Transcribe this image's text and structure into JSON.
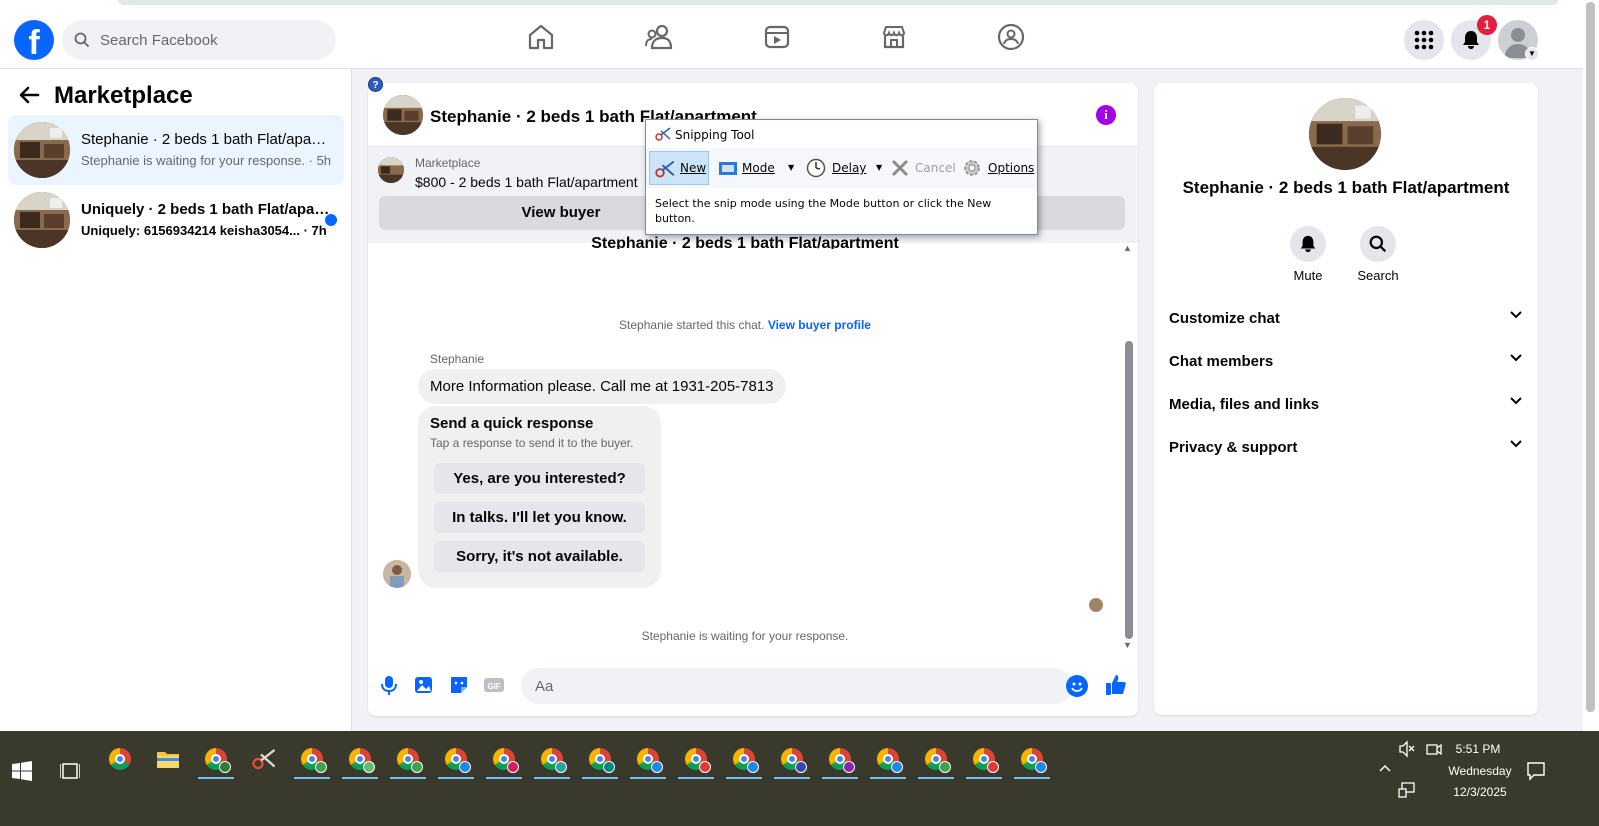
{
  "colors": {
    "brand": "#0866ff",
    "badge": "#e41e3f",
    "info": "#a400e6"
  },
  "topbar": {
    "search_placeholder": "Search Facebook",
    "nav_icons": [
      "home-icon",
      "friends-icon",
      "video-icon",
      "marketplace-icon",
      "groups-icon"
    ],
    "notification_count": "1"
  },
  "sidebar": {
    "title": "Marketplace",
    "conversations": [
      {
        "title": "Stephanie · 2 beds 1 bath Flat/apartment",
        "subtitle": "Stephanie is waiting for your response. · 5h",
        "active": true,
        "unread": false
      },
      {
        "title": "Uniquely · 2 beds 1 bath Flat/apartment",
        "subtitle": "Uniquely: 6156934214 keisha3054... · 7h",
        "active": false,
        "unread": true
      }
    ]
  },
  "chat": {
    "header_title": "Stephanie · 2 beds 1 bath Flat/apartment",
    "listing_source": "Marketplace",
    "listing_price": "$800 - 2 beds 1 bath Flat/apartment",
    "view_buyer_label": "View buyer",
    "topic": "Stephanie · 2 beds 1 bath Flat/apartment",
    "started_note": "Stephanie started this chat.",
    "started_link": "View buyer profile",
    "sender_name": "Stephanie",
    "message": "More Information please. Call me at 1931-205-7813",
    "quick_title": "Send a quick response",
    "quick_subtitle": "Tap a response to send it to the buyer.",
    "quick_responses": [
      "Yes, are you interested?",
      "In talks. I'll let you know.",
      "Sorry, it's not available."
    ],
    "waiting_note": "Stephanie is waiting for your response.",
    "input_placeholder": "Aa"
  },
  "details": {
    "title": "Stephanie · 2 beds 1 bath Flat/apartment",
    "actions": [
      "Mute",
      "Search"
    ],
    "sections": [
      "Customize chat",
      "Chat members",
      "Media, files and links",
      "Privacy & support"
    ]
  },
  "snipping_tool": {
    "title": "Snipping Tool",
    "buttons": {
      "new": "New",
      "mode": "Mode",
      "delay": "Delay",
      "cancel": "Cancel",
      "options": "Options"
    },
    "help_text": "Select the snip mode using the Mode button or click the New button."
  },
  "taskbar": {
    "time": "5:51 PM",
    "day": "Wednesday",
    "date": "12/3/2025"
  }
}
